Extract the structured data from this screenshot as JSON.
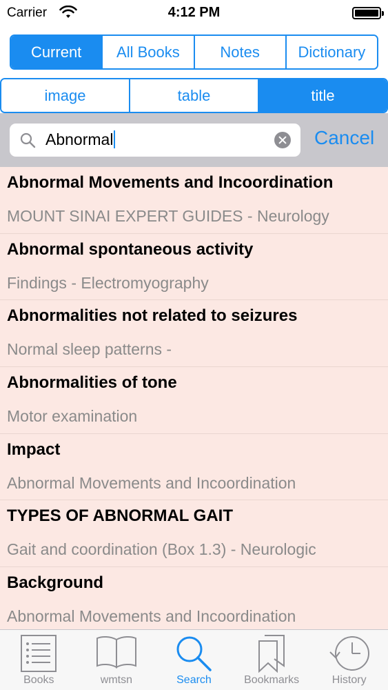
{
  "status_bar": {
    "carrier": "Carrier",
    "time": "4:12 PM"
  },
  "scope_tabs": [
    {
      "label": "Current",
      "active": true
    },
    {
      "label": "All Books",
      "active": false
    },
    {
      "label": "Notes",
      "active": false
    },
    {
      "label": "Dictionary",
      "active": false
    }
  ],
  "type_tabs": [
    {
      "label": "image",
      "active": false
    },
    {
      "label": "table",
      "active": false
    },
    {
      "label": "title",
      "active": true
    }
  ],
  "search": {
    "value": "Abnormal",
    "cancel_label": "Cancel",
    "icon": "search-icon",
    "clear_icon": "clear-icon"
  },
  "results": [
    {
      "title": "Abnormal Movements and Incoordination",
      "subtitle": "MOUNT SINAI EXPERT GUIDES - Neurology"
    },
    {
      "title": "Abnormal spontaneous activity",
      "subtitle": "Findings - Electromyography"
    },
    {
      "title": "Abnormalities not related to seizures",
      "subtitle": "Normal sleep patterns -"
    },
    {
      "title": "Abnormalities of tone",
      "subtitle": "Motor examination"
    },
    {
      "title": "Impact",
      "subtitle": "Abnormal Movements and Incoordination"
    },
    {
      "title": "TYPES OF ABNORMAL GAIT",
      "subtitle": "Gait and coordination (Box 1.3) - Neurologic"
    },
    {
      "title": "Background",
      "subtitle": "Abnormal Movements and Incoordination"
    }
  ],
  "tab_bar": [
    {
      "label": "Books",
      "icon": "list-icon",
      "active": false
    },
    {
      "label": "wmtsn",
      "icon": "open-book-icon",
      "active": false
    },
    {
      "label": "Search",
      "icon": "search-icon",
      "active": true
    },
    {
      "label": "Bookmarks",
      "icon": "bookmarks-icon",
      "active": false
    },
    {
      "label": "History",
      "icon": "history-icon",
      "active": false
    }
  ],
  "colors": {
    "accent": "#1a8cf0",
    "results_background": "#fce8e3",
    "subtitle_text": "#8a8a8a"
  }
}
